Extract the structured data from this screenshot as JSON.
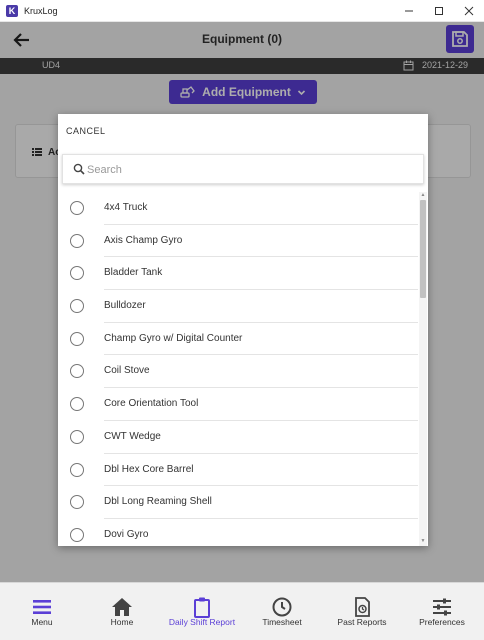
{
  "window": {
    "title": "KruxLog",
    "logo_letter": "K"
  },
  "header": {
    "title": "Equipment (0)"
  },
  "subbar": {
    "site": "UD4",
    "date": "2021-12-29"
  },
  "add_equipment": {
    "label": "Add Equipment"
  },
  "card": {
    "label": "Ac"
  },
  "modal": {
    "cancel_label": "CANCEL",
    "search": {
      "placeholder": "Search",
      "value": ""
    },
    "items": [
      {
        "label": "4x4 Truck",
        "selected": false
      },
      {
        "label": "Axis Champ Gyro",
        "selected": false
      },
      {
        "label": "Bladder Tank",
        "selected": false
      },
      {
        "label": "Bulldozer",
        "selected": false
      },
      {
        "label": "Champ Gyro w/ Digital Counter",
        "selected": false
      },
      {
        "label": "Coil Stove",
        "selected": false
      },
      {
        "label": "Core Orientation Tool",
        "selected": false
      },
      {
        "label": "CWT Wedge",
        "selected": false
      },
      {
        "label": "Dbl Hex Core Barrel",
        "selected": false
      },
      {
        "label": "Dbl Long Reaming Shell",
        "selected": false
      },
      {
        "label": "Dovi Gyro",
        "selected": false
      }
    ]
  },
  "bottom_nav": [
    {
      "label": "Menu",
      "icon": "menu-icon",
      "active": false
    },
    {
      "label": "Home",
      "icon": "home-icon",
      "active": false
    },
    {
      "label": "Daily Shift Report",
      "icon": "clipboard-icon",
      "active": true
    },
    {
      "label": "Timesheet",
      "icon": "clock-icon",
      "active": false
    },
    {
      "label": "Past Reports",
      "icon": "history-report-icon",
      "active": false
    },
    {
      "label": "Preferences",
      "icon": "sliders-icon",
      "active": false
    }
  ],
  "colors": {
    "accent": "#5b3fd6",
    "subbar": "#3e3e3e",
    "background": "#f1f1f1"
  }
}
